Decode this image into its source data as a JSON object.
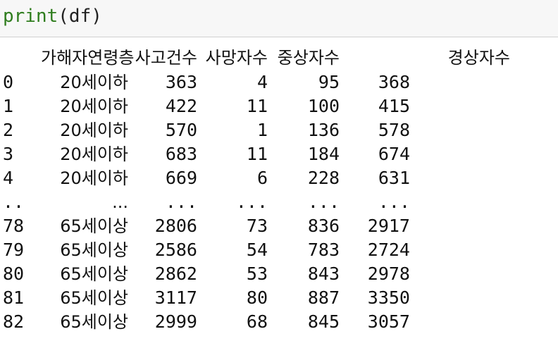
{
  "code": {
    "func": "print",
    "args": "(df)"
  },
  "table": {
    "headers": [
      "가해자연령층",
      "사고건수",
      "사망자수",
      "중상자수",
      "경상자수"
    ],
    "rows": [
      {
        "index": "0",
        "cells": [
          "20세이하",
          "363",
          "4",
          "95",
          "368"
        ]
      },
      {
        "index": "1",
        "cells": [
          "20세이하",
          "422",
          "11",
          "100",
          "415"
        ]
      },
      {
        "index": "2",
        "cells": [
          "20세이하",
          "570",
          "1",
          "136",
          "578"
        ]
      },
      {
        "index": "3",
        "cells": [
          "20세이하",
          "683",
          "11",
          "184",
          "674"
        ]
      },
      {
        "index": "4",
        "cells": [
          "20세이하",
          "669",
          "6",
          "228",
          "631"
        ]
      },
      {
        "index": "..",
        "cells": [
          "...",
          "...",
          "...",
          "...",
          "..."
        ]
      },
      {
        "index": "78",
        "cells": [
          "65세이상",
          "2806",
          "73",
          "836",
          "2917"
        ]
      },
      {
        "index": "79",
        "cells": [
          "65세이상",
          "2586",
          "54",
          "783",
          "2724"
        ]
      },
      {
        "index": "80",
        "cells": [
          "65세이상",
          "2862",
          "53",
          "843",
          "2978"
        ]
      },
      {
        "index": "81",
        "cells": [
          "65세이상",
          "3117",
          "80",
          "887",
          "3350"
        ]
      },
      {
        "index": "82",
        "cells": [
          "65세이상",
          "2999",
          "68",
          "845",
          "3057"
        ]
      }
    ]
  },
  "colors": {
    "builtin": "#2f7d1e",
    "code_background": "#f7f7f7"
  }
}
